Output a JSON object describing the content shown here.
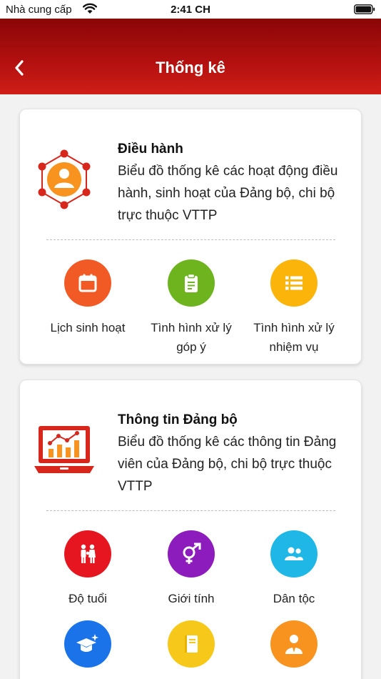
{
  "status_bar": {
    "carrier": "Nhà cung cấp",
    "time": "2:41 CH"
  },
  "header": {
    "title": "Thống kê"
  },
  "cards": [
    {
      "title": "Điều hành",
      "description": "Biểu đồ thống kê các hoạt động điều hành, sinh hoạt của Đảng bộ, chi bộ trực thuộc VTTP",
      "items": [
        {
          "label": "Lịch sinh hoạt",
          "icon": "calendar-icon",
          "color": "#f15a24"
        },
        {
          "label": "Tình hình xử lý góp ý",
          "icon": "clipboard-icon",
          "color": "#6eb41e"
        },
        {
          "label": "Tình hình xử lý nhiệm vụ",
          "icon": "list-icon",
          "color": "#fbb40a"
        }
      ]
    },
    {
      "title": "Thông tin Đảng bộ",
      "description": "Biểu đồ thống kê các thông tin Đảng viên của Đảng bộ, chi bộ trực thuộc VTTP",
      "items": [
        {
          "label": "Độ tuổi",
          "icon": "family-icon",
          "color": "#e5161f"
        },
        {
          "label": "Giới tính",
          "icon": "gender-icon",
          "color": "#8c1cbc"
        },
        {
          "label": "Dân tộc",
          "icon": "users-icon",
          "color": "#1fb8e6"
        },
        {
          "label": "",
          "icon": "graduation-icon",
          "color": "#1a73e8"
        },
        {
          "label": "",
          "icon": "book-icon",
          "color": "#f5c81a"
        },
        {
          "label": "",
          "icon": "member-icon",
          "color": "#f7931e"
        }
      ]
    }
  ],
  "colors": {
    "header_dark": "#8a0607",
    "header_light": "#cf1e17",
    "accent_red": "#d7261b",
    "accent_orange": "#f7931e"
  }
}
